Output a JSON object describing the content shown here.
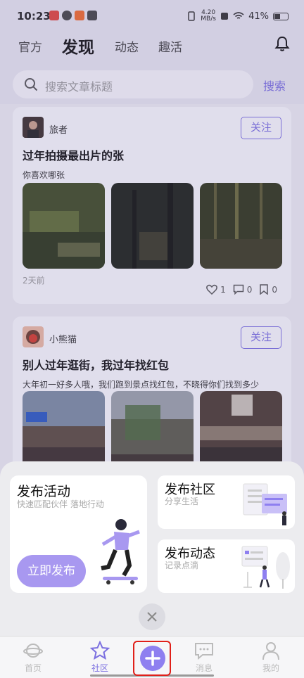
{
  "status_bar": {
    "time": "10:23",
    "speed": "4.20 MB/s",
    "battery": "41%"
  },
  "header": {
    "tabs": [
      {
        "label": "官方"
      },
      {
        "label": "发现"
      },
      {
        "label": "动态"
      },
      {
        "label": "趣活"
      }
    ]
  },
  "search": {
    "placeholder": "搜索文章标题",
    "button_label": "搜索"
  },
  "feed": {
    "posts": [
      {
        "author": "旅者",
        "follow_label": "关注",
        "title": "过年拍摄最出片的张",
        "description": "你喜欢哪张",
        "time_ago": "2天前",
        "likes": "1",
        "comments": "0",
        "bookmarks": "0"
      },
      {
        "author": "小熊猫",
        "follow_label": "关注",
        "title": "别人过年逛街，我过年找红包",
        "description": "大年初一好多人哦，我们跑到景点找红包，不晓得你们找到多少"
      }
    ]
  },
  "publish_sheet": {
    "activity": {
      "title": "发布活动",
      "subtitle": "快速匹配伙伴 落地行动",
      "button_label": "立即发布"
    },
    "community": {
      "title": "发布社区",
      "subtitle": "分享生活"
    },
    "moment": {
      "title": "发布动态",
      "subtitle": "记录点滴"
    }
  },
  "bottom_nav": {
    "items": [
      {
        "label": "首页"
      },
      {
        "label": "社区"
      },
      {
        "label": "消息"
      },
      {
        "label": "我的"
      }
    ]
  },
  "colors": {
    "accent": "#7b6fe0",
    "fab": "#8e7ff0",
    "publish_button": "#a898f0"
  }
}
